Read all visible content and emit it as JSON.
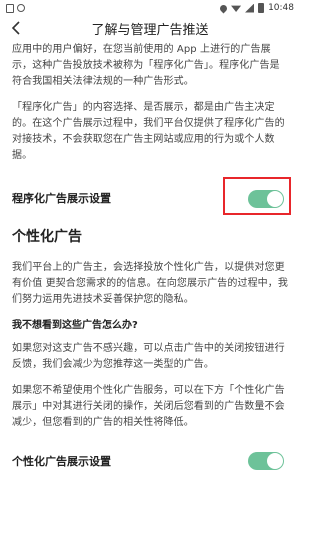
{
  "status_bar": {
    "time": "10:48",
    "icons": [
      "sim-icon",
      "circle-icon",
      "location-icon",
      "wifi-icon",
      "signal-icon",
      "battery-icon"
    ]
  },
  "nav": {
    "title": "了解与管理广告推送",
    "back_icon": "chevron-left-icon"
  },
  "paragraphs": {
    "p1": "应用中的用户偏好，在您当前使用的 App 上进行的广告展示，这种广告投放技术被称为「程序化广告」。程序化广告是符合我国相关法律法规的一种广告形式。",
    "p2": "「程序化广告」的内容选择、是否展示，都是由广告主决定的。在这个广告展示过程中，我们平台仅提供了程序化广告的对接技术，不会获取您在广告主网站或应用的行为或个人数据。",
    "p3": "我们平台上的广告主，会选择投放个性化广告，以提供对您更有价值 更契合您需求的的信息。在向您展示广告的过程中，我们努力运用先进技术妥善保护您的隐私。",
    "p4": "如果您对这支广告不感兴趣，可以点击广告中的关闭按钮进行反馈，我们会减少为您推荐这一类型的广告。",
    "p5": "如果您不希望使用个性化广告服务，可以在下方「个性化广告展示」中对其进行关闭的操作，关闭后您看到的广告数量不会减少，但您看到的广告的相关性将降低。"
  },
  "settings": {
    "programmatic_label": "程序化广告展示设置",
    "programmatic_enabled": true,
    "personalized_label": "个性化广告展示设置",
    "personalized_enabled": true
  },
  "sections": {
    "personalized_title": "个性化广告",
    "faq_title": "我不想看到这些广告怎么办?"
  },
  "colors": {
    "toggle_on": "#6dc299",
    "highlight": "#e8262b"
  }
}
